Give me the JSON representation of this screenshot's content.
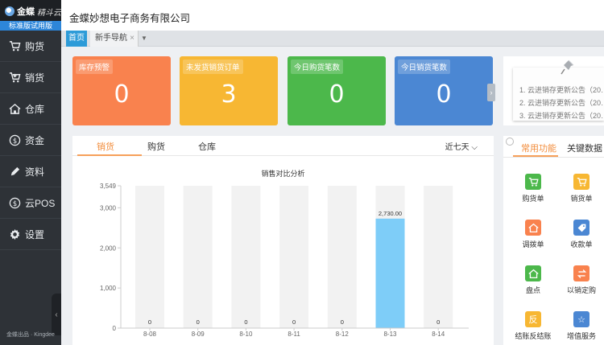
{
  "app": {
    "logo_text": "金蝶",
    "logo_sub": "精斗云",
    "edition": "标准版试用版",
    "copyright": "金蝶出品 · Kingdee"
  },
  "sidebar": {
    "items": [
      {
        "label": "购货",
        "icon": "cart-icon"
      },
      {
        "label": "销货",
        "icon": "cart-out-icon"
      },
      {
        "label": "仓库",
        "icon": "warehouse-icon"
      },
      {
        "label": "资金",
        "icon": "money-icon"
      },
      {
        "label": "资料",
        "icon": "pencil-icon"
      },
      {
        "label": "云POS",
        "icon": "pos-icon"
      },
      {
        "label": "设置",
        "icon": "gear-icon"
      }
    ],
    "collapse": "‹"
  },
  "header": {
    "company": "金蝶妙想电子商务有限公司"
  },
  "tabs": {
    "home": "首页",
    "guide": "新手导航",
    "close": "×",
    "dropdown": "▼"
  },
  "cards": [
    {
      "label": "库存预警",
      "value": "0",
      "color": "#f9824e"
    },
    {
      "label": "未发货销货订单",
      "value": "3",
      "color": "#f7b733"
    },
    {
      "label": "今日购货笔数",
      "value": "0",
      "color": "#4cb84b"
    },
    {
      "label": "今日销货笔数",
      "value": "0",
      "color": "#4b87d3"
    }
  ],
  "card_arrow": "›",
  "notice": {
    "items": [
      "1. 云进销存更新公告（20…",
      "2. 云进销存更新公告（20…",
      "3. 云进销存更新公告（20…"
    ]
  },
  "chart_panel": {
    "tabs": [
      "销货",
      "购货",
      "仓库"
    ],
    "active_tab": 0,
    "range": "近七天"
  },
  "chart_data": {
    "type": "bar",
    "title": "销售对比分析",
    "categories": [
      "8-08",
      "8-09",
      "8-10",
      "8-11",
      "8-12",
      "8-13",
      "8-14"
    ],
    "values": [
      0,
      0,
      0,
      0,
      0,
      2730,
      0
    ],
    "value_labels": [
      "0",
      "0",
      "0",
      "0",
      "0",
      "2,730.00",
      "0"
    ],
    "ylim": [
      0,
      3549
    ],
    "yticks": [
      0,
      1000,
      2000,
      3000,
      3549
    ],
    "ytick_labels": [
      "0",
      "1,000",
      "2,000",
      "3,000",
      "3,549"
    ],
    "background_bar_color": "#f2f2f2",
    "bar_color": "#7ecdf8",
    "xlabel": "",
    "ylabel": ""
  },
  "right_panel": {
    "tabs": [
      "常用功能",
      "关键数据"
    ],
    "functions": [
      {
        "label": "购货单",
        "icon": "cart-icon",
        "color": "#4cb84b",
        "glyph": "🛒"
      },
      {
        "label": "销货单",
        "icon": "cart-out-icon",
        "color": "#f7b733",
        "glyph": "🛒"
      },
      {
        "label": "调拨单",
        "icon": "warehouse-icon",
        "color": "#f9824e",
        "glyph": "⌂"
      },
      {
        "label": "收款单",
        "icon": "tag-icon",
        "color": "#4b87d3",
        "glyph": "◆"
      },
      {
        "label": "盘点",
        "icon": "warehouse-icon",
        "color": "#4cb84b",
        "glyph": "⌂"
      },
      {
        "label": "以销定购",
        "icon": "swap-icon",
        "color": "#f9824e",
        "glyph": "⇄"
      },
      {
        "label": "结账反结账",
        "icon": "reverse-icon",
        "color": "#f7b733",
        "glyph": "反"
      },
      {
        "label": "增值服务",
        "icon": "star-icon",
        "color": "#4b87d3",
        "glyph": "☆"
      }
    ]
  }
}
